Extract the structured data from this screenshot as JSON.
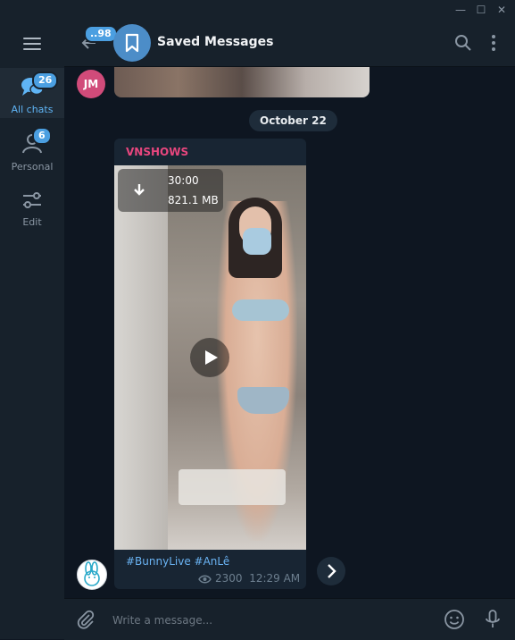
{
  "window": {
    "minimize_glyph": "—",
    "maximize_glyph": "☐",
    "close_glyph": "✕"
  },
  "sidebar": {
    "menu_icon": "hamburger-icon",
    "folders": [
      {
        "label": "All chats",
        "badge": "26",
        "icon": "chats-icon",
        "active": true
      },
      {
        "label": "Personal",
        "badge": "6",
        "icon": "person-icon",
        "active": false
      },
      {
        "label": "Edit",
        "badge": null,
        "icon": "sliders-icon",
        "active": false
      }
    ]
  },
  "header": {
    "back_badge": "..98",
    "title": "Saved Messages",
    "avatar_icon": "bookmark-icon",
    "accent_color": "#4c8dc8"
  },
  "chat": {
    "previous_sender_initials": "JM",
    "date_separator": "October 22",
    "message": {
      "sender": "VNSHOWS",
      "sender_color": "#e8467e",
      "video": {
        "duration": "30:00",
        "size": "821.1 MB"
      },
      "caption": "#BunnyLive #AnLê",
      "views": "2300",
      "time": "12:29 AM"
    }
  },
  "composer": {
    "placeholder": "Write a message..."
  }
}
